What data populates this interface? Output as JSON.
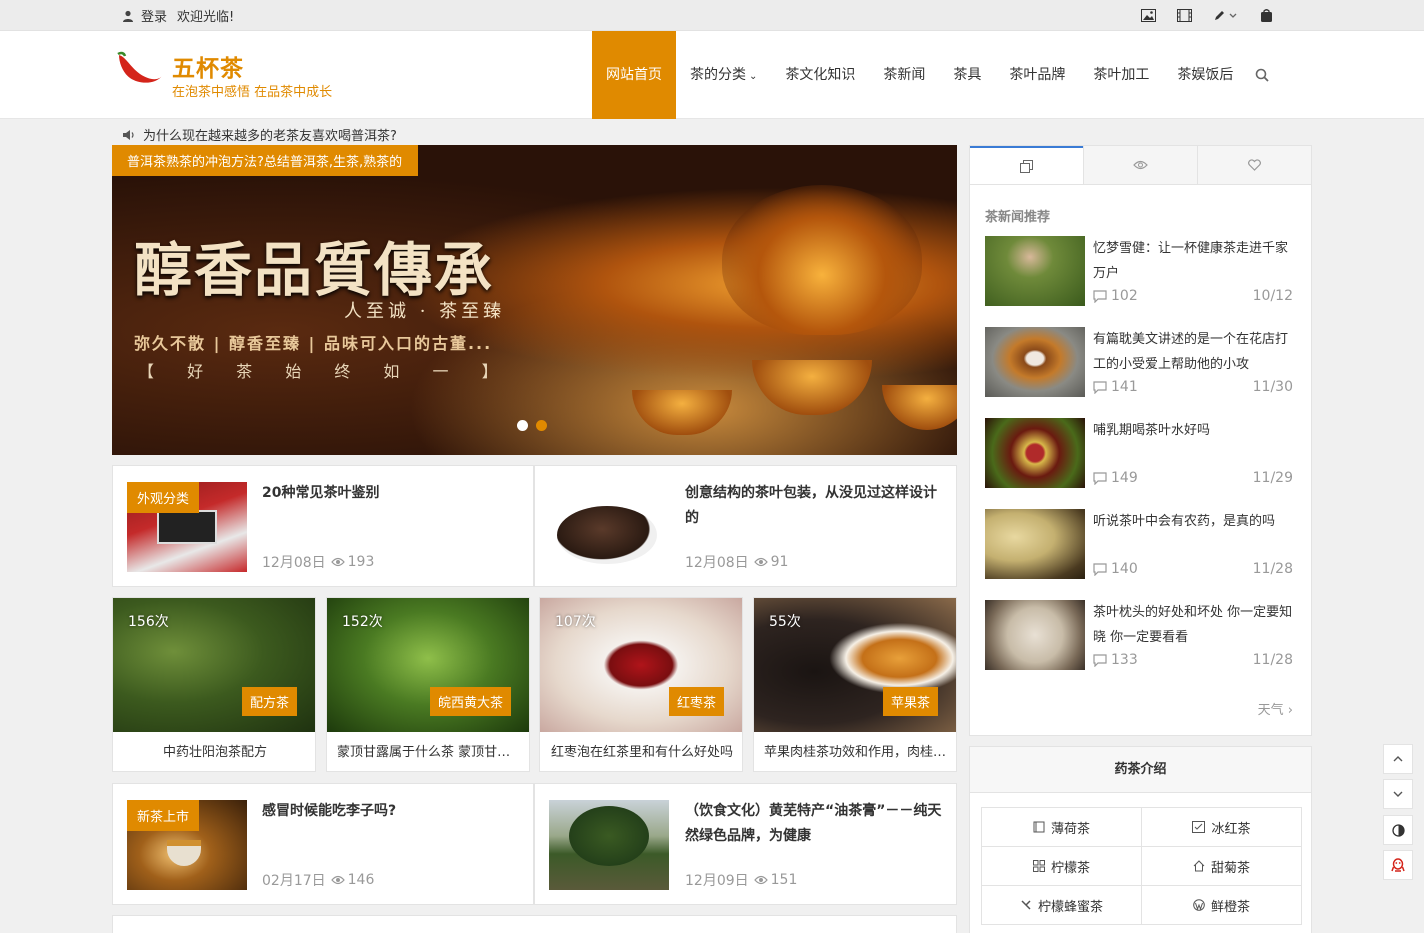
{
  "topbar": {
    "login": "登录",
    "welcome": "欢迎光临!"
  },
  "site": {
    "title": "五杯茶",
    "subtitle": "在泡茶中感悟 在品茶中成长"
  },
  "nav": [
    {
      "label": "网站首页"
    },
    {
      "label": "茶的分类"
    },
    {
      "label": "茶文化知识"
    },
    {
      "label": "茶新闻"
    },
    {
      "label": "茶具"
    },
    {
      "label": "茶叶品牌"
    },
    {
      "label": "茶叶加工"
    },
    {
      "label": "茶娱饭后"
    }
  ],
  "notice": "为什么现在越来越多的老茶友喜欢喝普洱茶?",
  "slider": {
    "tag": "普洱茶熟茶的冲泡方法?总结普洱茶,生茶,熟茶的",
    "headline": "醇香品質傳承",
    "line1": "人至诚 · 茶至臻",
    "line2": "弥久不散 | 醇香至臻 | 品味可入口的古董...",
    "line3": "【 好 茶 始 终 如 一 】"
  },
  "posts": [
    {
      "badge": "外观分类",
      "title": "20种常见茶叶鉴别",
      "date": "12月08日",
      "views": "193"
    },
    {
      "badge": "",
      "title": "创意结构的茶叶包装，从没见过这样设计的",
      "date": "12月08日",
      "views": "91"
    },
    {
      "badge": "新茶上市",
      "title": "感冒时候能吃李子吗?",
      "date": "02月17日",
      "views": "146"
    },
    {
      "badge": "",
      "title": "（饮食文化）黄芜特产“油茶膏”－－纯天然绿色品牌，为健康",
      "date": "12月09日",
      "views": "151"
    }
  ],
  "grid": [
    {
      "views": "156次",
      "tag": "配方茶",
      "title": "中药壮阳泡茶配方"
    },
    {
      "views": "152次",
      "tag": "皖西黄大茶",
      "title": "蒙顶甘露属于什么茶 蒙顶甘露的特点"
    },
    {
      "views": "107次",
      "tag": "红枣茶",
      "title": "红枣泡在红茶里和有什么好处吗"
    },
    {
      "views": "55次",
      "tag": "苹果茶",
      "title": "苹果肉桂茶功效和作用，肉桂茶的做法"
    }
  ],
  "sidebar": {
    "heading": "茶新闻推荐",
    "items": [
      {
        "title": "忆梦雪健：让一杯健康茶走进千家万户",
        "comments": "102",
        "date": "10/12"
      },
      {
        "title": "有篇耽美文讲述的是一个在花店打工的小受爱上帮助他的小攻",
        "comments": "141",
        "date": "11/30"
      },
      {
        "title": "哺乳期喝茶叶水好吗",
        "comments": "149",
        "date": "11/29"
      },
      {
        "title": "听说茶叶中会有农药，是真的吗",
        "comments": "140",
        "date": "11/28"
      },
      {
        "title": "茶叶枕头的好处和坏处 你一定要知晓 你一定要看看",
        "comments": "133",
        "date": "11/28"
      }
    ],
    "more": "天气"
  },
  "herbal": {
    "title": "药茶介绍",
    "items": [
      {
        "label": "薄荷茶"
      },
      {
        "label": "冰红茶"
      },
      {
        "label": "柠檬茶"
      },
      {
        "label": "甜菊茶"
      },
      {
        "label": "柠檬蜂蜜茶"
      },
      {
        "label": "鲜橙茶"
      }
    ]
  },
  "colors": {
    "accent": "#e08a00",
    "tab_active": "#3a7bd5"
  }
}
